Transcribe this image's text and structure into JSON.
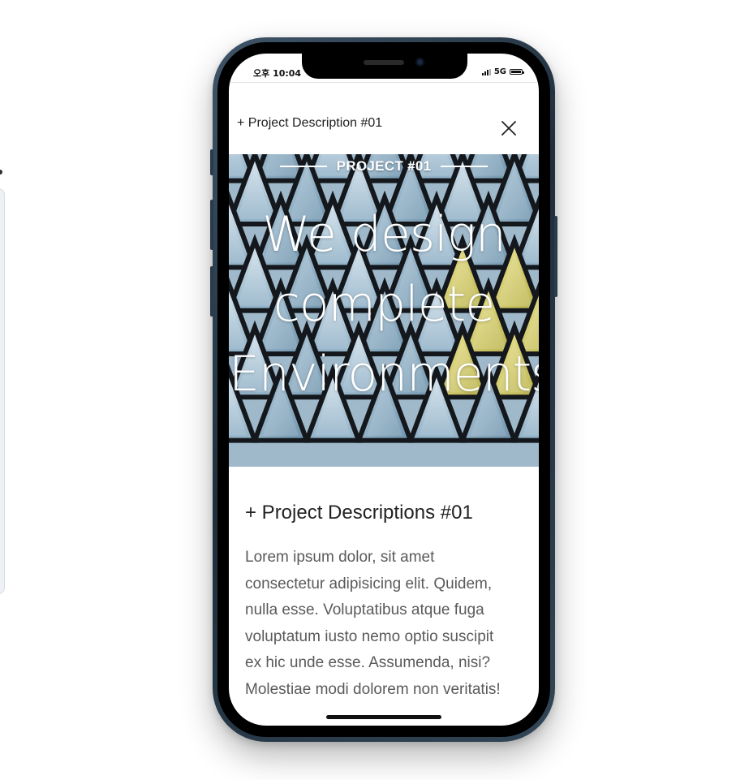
{
  "status_bar": {
    "time": "오후 10:04",
    "network": "5G",
    "battery_level": 1.0
  },
  "modal": {
    "title": "+ Project Description #01",
    "close_icon": "close-icon"
  },
  "hero": {
    "kicker": "PROJECT #01",
    "headline_lines": [
      "We design",
      "complete",
      "Environments"
    ]
  },
  "content": {
    "title": "+ Project Descriptions #01",
    "paragraph_lines": [
      "Lorem ipsum dolor, sit amet",
      "consectetur adipisicing elit. Quidem,",
      "nulla esse. Voluptatibus atque fuga",
      "voluptatum iusto nemo optio suscipit",
      "ex hic unde esse. Assumenda, nisi?",
      "Molestiae modi dolorem non veritatis!"
    ]
  },
  "colors": {
    "phone_frame": "#2b3d4d",
    "text_dark": "#222222",
    "text_body": "#5a5a5a",
    "glass_blue": "#a9c4d8",
    "glass_yellow": "#e2d96a"
  }
}
